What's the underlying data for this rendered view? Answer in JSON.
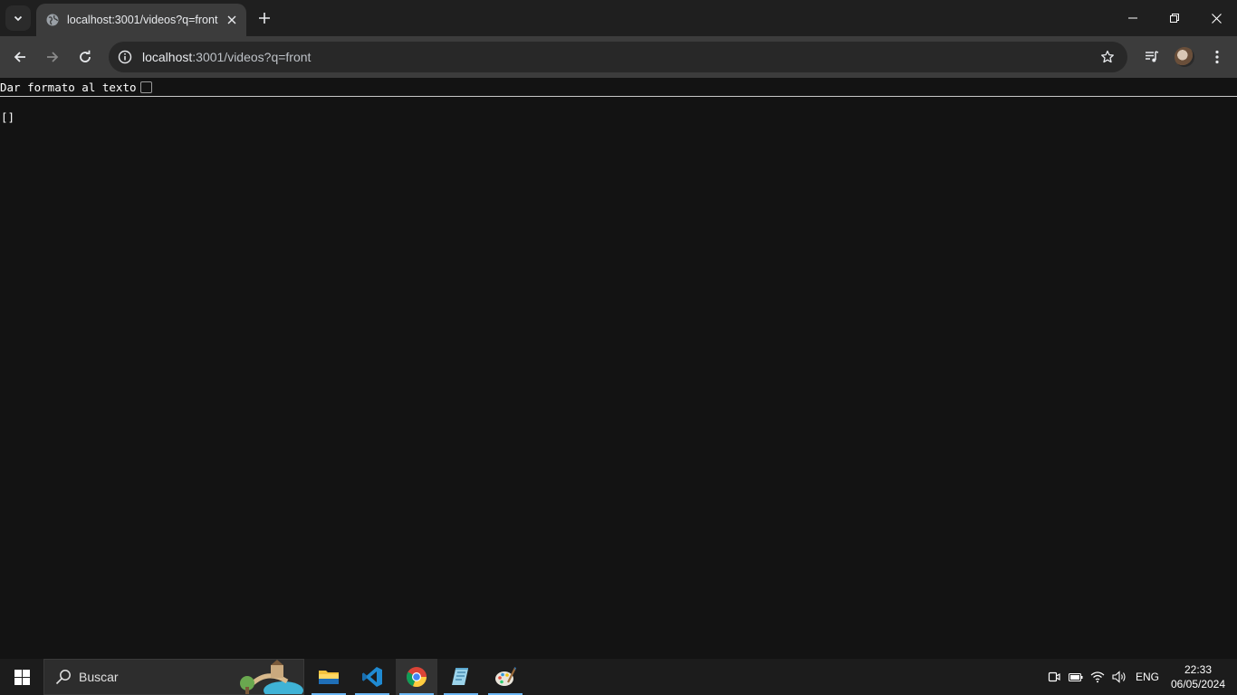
{
  "browser": {
    "tab": {
      "title": "localhost:3001/videos?q=front"
    },
    "address_bar": {
      "host": "localhost",
      "rest": ":3001/videos?q=front"
    }
  },
  "page": {
    "pretty_print_label": "Dar formato al texto",
    "pretty_print_checked": false,
    "json_text": "[]"
  },
  "taskbar": {
    "search_placeholder": "Buscar",
    "apps": [
      "file-explorer",
      "vscode",
      "chrome",
      "notepad",
      "paint"
    ],
    "tray": {
      "language": "ENG",
      "time": "22:33",
      "date": "06/05/2024"
    }
  },
  "colors": {
    "page_bg": "#131313",
    "tab_bg": "#3c3c3c",
    "titlebar_bg": "#1f1f1f",
    "taskbar_bg": "#1c1c1c",
    "accent": "#6cb8f6"
  }
}
